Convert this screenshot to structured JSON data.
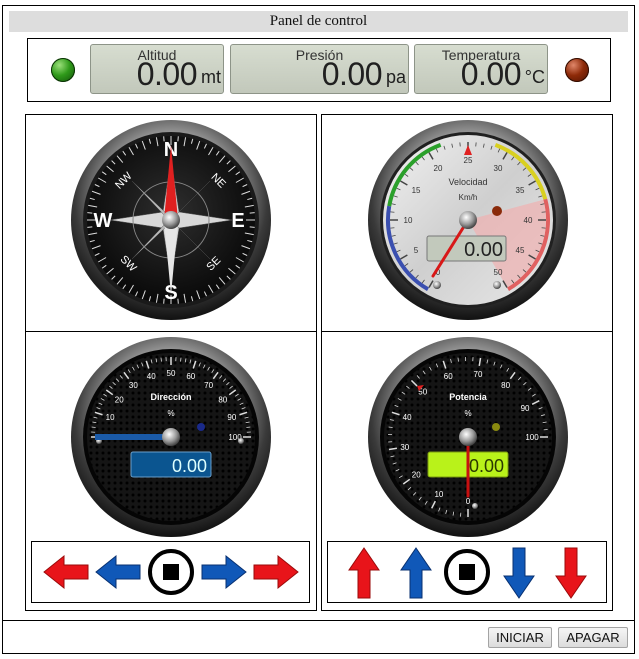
{
  "window": {
    "title": "Panel de control"
  },
  "indicators": {
    "left_led_color": "#2f9a1a",
    "right_led_color": "#8e2a08"
  },
  "readouts": [
    {
      "label": "Altitud",
      "value": "0.00",
      "unit": "mt"
    },
    {
      "label": "Presión",
      "value": "0.00",
      "unit": "pa"
    },
    {
      "label": "Temperatura",
      "value": "0.00",
      "unit": "°C"
    }
  ],
  "compass": {
    "cardinals": [
      "N",
      "E",
      "S",
      "W"
    ],
    "intercardinals": [
      "NE",
      "SE",
      "SW",
      "NW"
    ],
    "heading_deg": 0
  },
  "speed_gauge": {
    "title": "Velocidad",
    "unit": "Km/h",
    "ticks": [
      "0",
      "5",
      "10",
      "15",
      "20",
      "25",
      "30",
      "35",
      "40",
      "45",
      "50"
    ],
    "value": "0.00",
    "needle_value": 0
  },
  "direction_gauge": {
    "title": "Dirección",
    "unit": "%",
    "ticks": [
      "0",
      "10",
      "20",
      "30",
      "40",
      "50",
      "60",
      "70",
      "80",
      "90",
      "100"
    ],
    "value": "0.00",
    "bar_value": 0
  },
  "power_gauge": {
    "title": "Potencia",
    "unit": "%",
    "ticks": [
      "0",
      "10",
      "20",
      "30",
      "40",
      "50",
      "60",
      "70",
      "80",
      "90",
      "100"
    ],
    "value": "0.00",
    "needle_value": 0
  },
  "steering_controls": {
    "items": [
      "arrow-left-fast",
      "arrow-left",
      "stop",
      "arrow-right",
      "arrow-right-fast"
    ]
  },
  "throttle_controls": {
    "items": [
      "arrow-up-fast",
      "arrow-up",
      "stop",
      "arrow-down",
      "arrow-down-fast"
    ]
  },
  "buttons": {
    "start": "INICIAR",
    "stop": "APAGAR"
  },
  "colors": {
    "red_arrow": "#e8141a",
    "blue_arrow": "#1058b8",
    "lcd_green": "#b9f21a",
    "lcd_blue": "#0b5590"
  }
}
